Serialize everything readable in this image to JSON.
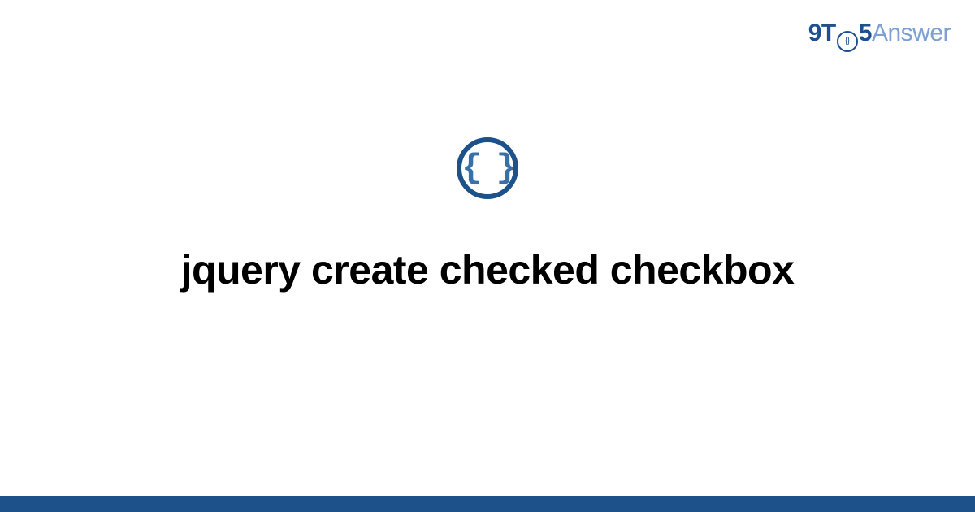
{
  "logo": {
    "part1": "9T",
    "part2": "5",
    "part3": "Answer",
    "clock_inner": "{}"
  },
  "icon": {
    "glyph": "{ }"
  },
  "title": "jquery create checked checkbox",
  "colors": {
    "brand_dark": "#1d5189",
    "brand_light": "#7aa0d4",
    "text": "#000000",
    "background": "#ffffff"
  }
}
